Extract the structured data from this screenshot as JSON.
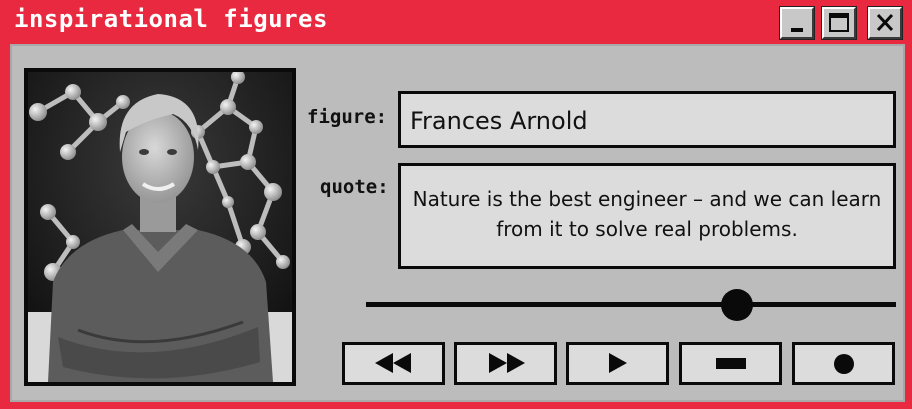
{
  "window": {
    "title": "inspirational figures",
    "controls": [
      "minimize-icon",
      "maximize-icon",
      "close-icon"
    ]
  },
  "colors": {
    "frame": "#e8293f",
    "panel": "#bcbcbc",
    "field": "#dcdcdc",
    "ink": "#0a0a0a"
  },
  "profile": {
    "figure_label": "figure:",
    "figure_value": "Frances Arnold",
    "quote_label": "quote:",
    "quote_value": "Nature is the best engineer – and we can learn from it to solve real problems."
  },
  "playback": {
    "progress": 0.7,
    "buttons": [
      "rewind-icon",
      "fast-forward-icon",
      "play-icon",
      "stop-icon",
      "record-icon"
    ]
  }
}
